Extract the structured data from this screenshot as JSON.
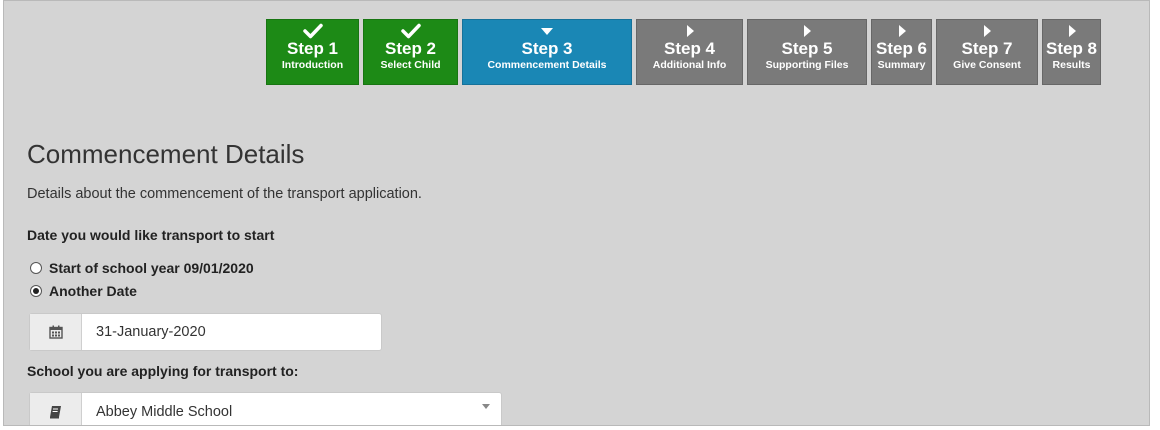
{
  "stepper": {
    "steps": [
      {
        "title": "Step 1",
        "subtitle": "Introduction",
        "status": "done",
        "icon": "check-icon"
      },
      {
        "title": "Step 2",
        "subtitle": "Select Child",
        "status": "done",
        "icon": "check-icon"
      },
      {
        "title": "Step 3",
        "subtitle": "Commencement Details",
        "status": "current",
        "icon": "caret-down-icon"
      },
      {
        "title": "Step 4",
        "subtitle": "Additional Info",
        "status": "todo",
        "icon": "caret-right-icon"
      },
      {
        "title": "Step 5",
        "subtitle": "Supporting Files",
        "status": "todo",
        "icon": "caret-right-icon"
      },
      {
        "title": "Step 6",
        "subtitle": "Summary",
        "status": "todo",
        "icon": "caret-right-icon"
      },
      {
        "title": "Step 7",
        "subtitle": "Give Consent",
        "status": "todo",
        "icon": "caret-right-icon"
      },
      {
        "title": "Step 8",
        "subtitle": "Results",
        "status": "todo",
        "icon": "caret-right-icon"
      }
    ],
    "colors": {
      "done": "#1d8a16",
      "current": "#1a87b5",
      "todo": "#7a7a7a"
    }
  },
  "page": {
    "title": "Commencement Details",
    "description": "Details about the commencement of the transport application."
  },
  "start_date": {
    "label": "Date you would like transport to start",
    "options": [
      {
        "label": "Start of school year 09/01/2020",
        "selected": false
      },
      {
        "label": "Another Date",
        "selected": true
      }
    ],
    "date_value": "31-January-2020",
    "date_icon": "calendar-icon"
  },
  "school": {
    "label": "School you are applying for transport to:",
    "selected": "Abbey Middle School",
    "icon": "book-icon"
  }
}
